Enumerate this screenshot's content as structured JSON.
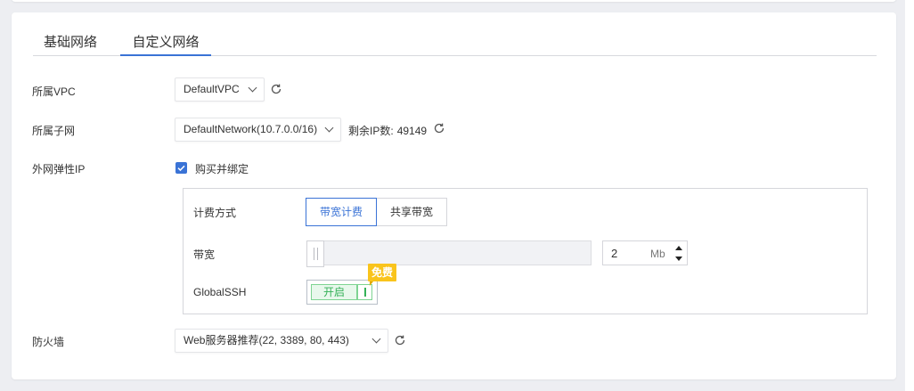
{
  "tabs": [
    {
      "label": "基础网络",
      "active": false
    },
    {
      "label": "自定义网络",
      "active": true
    }
  ],
  "form": {
    "vpc": {
      "label": "所属VPC",
      "value": "DefaultVPC"
    },
    "subnet": {
      "label": "所属子网",
      "value": "DefaultNetwork(10.7.0.0/16)",
      "ip_label": "剩余IP数:",
      "ip_count": "49149"
    },
    "eip": {
      "label": "外网弹性IP",
      "checkbox_label": "购买并绑定",
      "checked": true
    },
    "billing": {
      "label": "计费方式",
      "options": [
        "带宽计费",
        "共享带宽"
      ],
      "selected": "带宽计费"
    },
    "bandwidth": {
      "label": "带宽",
      "value": "2",
      "unit": "Mb",
      "slider_fraction": 0
    },
    "globalssh": {
      "label": "GlobalSSH",
      "toggle_label": "开启",
      "enabled": true,
      "badge": "免费"
    },
    "firewall": {
      "label": "防火墙",
      "value": "Web服务器推荐(22, 3389, 80, 443)"
    }
  },
  "colors": {
    "accent": "#3a73d6",
    "toggle_green": "#35b158",
    "badge_yellow": "#f9c41c"
  },
  "icons": {
    "refresh": "refresh-icon",
    "dropdown": "chevron-down-icon",
    "check": "check-icon"
  }
}
